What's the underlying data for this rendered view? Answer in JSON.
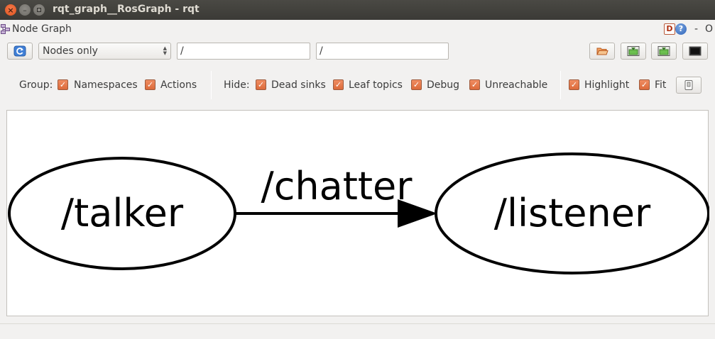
{
  "window": {
    "title": "rqt_graph__RosGraph - rqt"
  },
  "plugin": {
    "title": "Node Graph",
    "d_label": "D",
    "help_label": "?",
    "dash_label": "-",
    "o_label": "O"
  },
  "toolbar": {
    "mode_select": "Nodes only",
    "filter_1": "/",
    "filter_2": "/"
  },
  "options": {
    "group_label": "Group:",
    "hide_label": "Hide:",
    "items": [
      {
        "label": "Namespaces",
        "checked": true
      },
      {
        "label": "Actions",
        "checked": true
      },
      {
        "label": "Dead sinks",
        "checked": true
      },
      {
        "label": "Leaf topics",
        "checked": true
      },
      {
        "label": "Debug",
        "checked": true
      },
      {
        "label": "Unreachable",
        "checked": true
      },
      {
        "label": "Highlight",
        "checked": true
      },
      {
        "label": "Fit",
        "checked": true
      }
    ],
    "check_glyph": "✓"
  },
  "graph": {
    "nodes": [
      {
        "name": "/talker"
      },
      {
        "name": "/listener"
      }
    ],
    "edges": [
      {
        "from": "/talker",
        "to": "/listener",
        "topic": "/chatter"
      }
    ]
  },
  "colors": {
    "checkbox": "#e07446",
    "titlebar": "#3f3e3a",
    "canvas": "#ffffff"
  }
}
